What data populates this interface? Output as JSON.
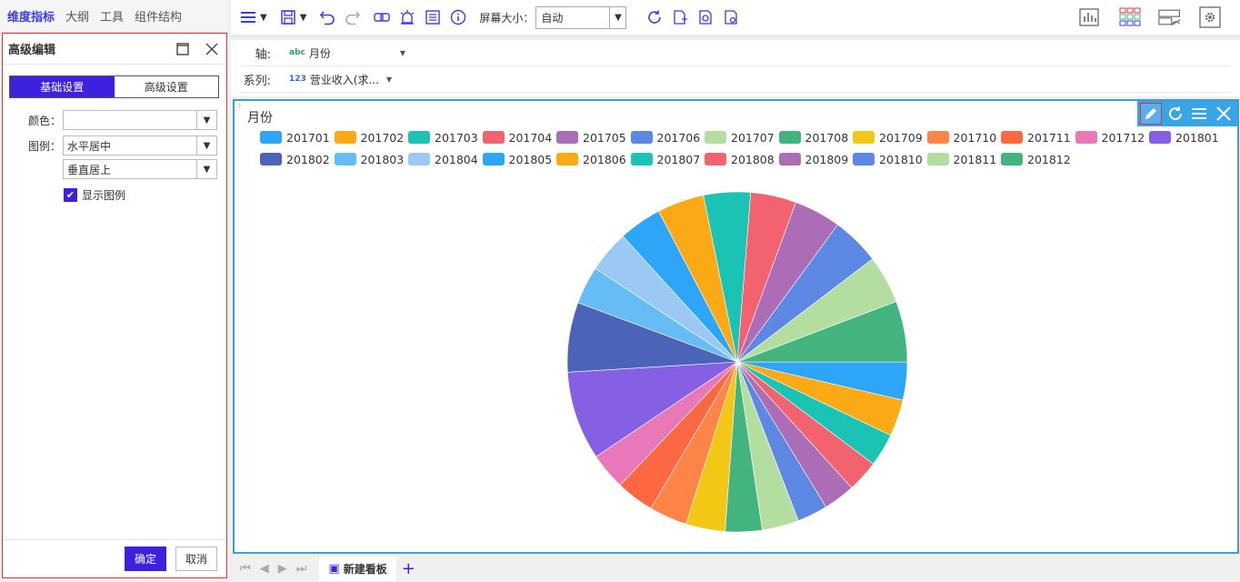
{
  "nav_tabs": [
    "维度指标",
    "大纲",
    "工具",
    "组件结构"
  ],
  "panel": {
    "title": "高级编辑",
    "tabs": [
      "基础设置",
      "高级设置"
    ],
    "color_label": "颜色：",
    "color_value": "",
    "legend_label": "图例：",
    "legend_h_value": "水平居中",
    "legend_v_value": "垂直居上",
    "show_legend_label": "显示图例",
    "show_legend_checked": true,
    "ok_label": "确定",
    "cancel_label": "取消"
  },
  "toolbar": {
    "screen_size_label": "屏幕大小：",
    "screen_size_value": "自动"
  },
  "fields": {
    "axis_label": "轴:",
    "axis_type": "abc",
    "axis_field": "月份",
    "series_label": "系列:",
    "series_type": "123",
    "series_field": "营业收入(求..."
  },
  "card": {
    "title": "月份"
  },
  "bottom": {
    "sheet_tab": "新建看板"
  },
  "chart_data": {
    "type": "pie",
    "title": "月份",
    "legend_placement": "top-center",
    "categories": [
      "201701",
      "201702",
      "201703",
      "201704",
      "201705",
      "201706",
      "201707",
      "201708",
      "201709",
      "201710",
      "201711",
      "201712",
      "201801",
      "201802",
      "201803",
      "201804",
      "201805",
      "201806",
      "201807",
      "201808",
      "201809",
      "201810",
      "201811",
      "201812"
    ],
    "values": [
      3.0,
      2.9,
      2.6,
      2.5,
      2.5,
      2.4,
      2.9,
      2.9,
      3.1,
      3.0,
      3.0,
      2.9,
      7.0,
      5.5,
      3.0,
      3.3,
      3.4,
      3.7,
      3.7,
      3.6,
      3.7,
      3.8,
      3.8,
      4.8
    ],
    "colors": [
      "#2ea6f7",
      "#fbaa16",
      "#1bc3b4",
      "#f2626f",
      "#ab6db5",
      "#5c87e2",
      "#b3dea0",
      "#44b47f",
      "#f2c716",
      "#fe8447",
      "#fd6741",
      "#e978b8",
      "#8660e2",
      "#4c64b8",
      "#66bdf6",
      "#9cc9f4",
      "#2ea6f7",
      "#fbaa16",
      "#1bc3b4",
      "#f2626f",
      "#ab6db5",
      "#5c87e2",
      "#b3dea0",
      "#44b47f"
    ]
  }
}
